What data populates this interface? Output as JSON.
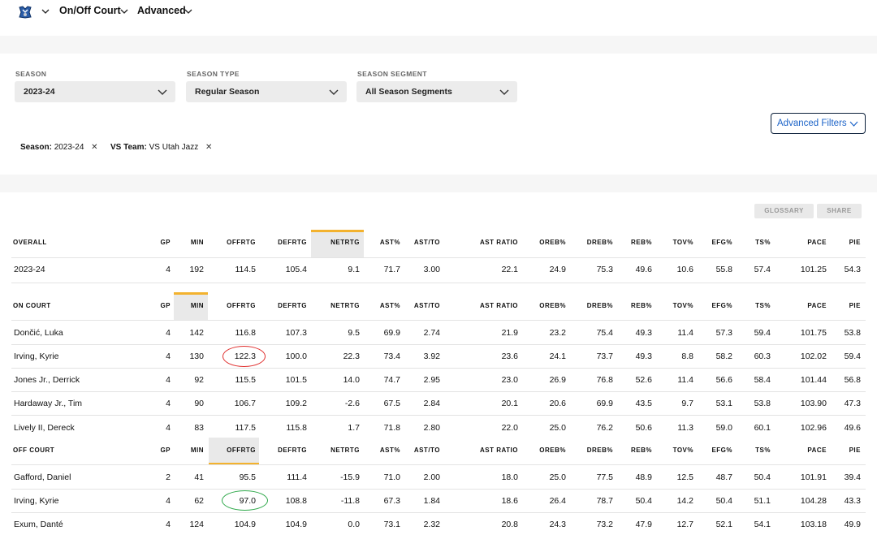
{
  "nav": {
    "team_logo": "mavericks-logo",
    "section": "On/Off Court",
    "mode": "Advanced"
  },
  "filters": {
    "season": {
      "label": "SEASON",
      "value": "2023-24"
    },
    "season_type": {
      "label": "SEASON TYPE",
      "value": "Regular Season"
    },
    "season_segment": {
      "label": "SEASON SEGMENT",
      "value": "All Season Segments"
    },
    "advanced_filters": "Advanced Filters"
  },
  "active_filters": [
    {
      "key": "Season:",
      "value": "2023-24"
    },
    {
      "key": "VS Team:",
      "value": "VS Utah Jazz"
    }
  ],
  "actions": {
    "glossary": "GLOSSARY",
    "share": "SHARE"
  },
  "colors": {
    "accent": "#f3b22e",
    "link": "#1d64c8",
    "red_circle": "#e0302f",
    "green_circle": "#2ea84a"
  },
  "columns": [
    "GP",
    "MIN",
    "OFFRTG",
    "DEFRTG",
    "NETRTG",
    "AST%",
    "AST/TO",
    "AST RATIO",
    "OREB%",
    "DREB%",
    "REB%",
    "TOV%",
    "EFG%",
    "TS%",
    "PACE",
    "PIE"
  ],
  "overall": {
    "title": "OVERALL",
    "highlight_column": "NETRTG",
    "rows": [
      {
        "name": "2023-24",
        "values": [
          "4",
          "192",
          "114.5",
          "105.4",
          "9.1",
          "71.7",
          "3.00",
          "22.1",
          "24.9",
          "75.3",
          "49.6",
          "10.6",
          "55.8",
          "57.4",
          "101.25",
          "54.3"
        ]
      }
    ]
  },
  "on_court": {
    "title": "ON COURT",
    "highlight_column": "MIN",
    "rows": [
      {
        "name": "Dončić, Luka",
        "values": [
          "4",
          "142",
          "116.8",
          "107.3",
          "9.5",
          "69.9",
          "2.74",
          "21.9",
          "23.2",
          "75.4",
          "49.3",
          "11.4",
          "57.3",
          "59.4",
          "101.75",
          "53.8"
        ]
      },
      {
        "name": "Irving, Kyrie",
        "values": [
          "4",
          "130",
          "122.3",
          "100.0",
          "22.3",
          "73.4",
          "3.92",
          "23.6",
          "24.1",
          "73.7",
          "49.3",
          "8.8",
          "58.2",
          "60.3",
          "102.02",
          "59.4"
        ]
      },
      {
        "name": "Jones Jr., Derrick",
        "values": [
          "4",
          "92",
          "115.5",
          "101.5",
          "14.0",
          "74.7",
          "2.95",
          "23.0",
          "26.9",
          "76.8",
          "52.6",
          "11.4",
          "56.6",
          "58.4",
          "101.44",
          "56.8"
        ]
      },
      {
        "name": "Hardaway Jr., Tim",
        "values": [
          "4",
          "90",
          "106.7",
          "109.2",
          "-2.6",
          "67.5",
          "2.84",
          "20.1",
          "20.6",
          "69.9",
          "43.5",
          "9.7",
          "53.1",
          "53.8",
          "103.90",
          "47.3"
        ]
      },
      {
        "name": "Lively II, Dereck",
        "values": [
          "4",
          "83",
          "117.5",
          "115.8",
          "1.7",
          "71.8",
          "2.80",
          "22.0",
          "25.0",
          "76.2",
          "50.6",
          "11.3",
          "59.0",
          "60.1",
          "102.96",
          "49.6"
        ]
      }
    ]
  },
  "off_court": {
    "title": "OFF COURT",
    "highlight_column": "OFFRTG",
    "rows": [
      {
        "name": "Gafford, Daniel",
        "values": [
          "2",
          "41",
          "95.5",
          "111.4",
          "-15.9",
          "71.0",
          "2.00",
          "18.0",
          "25.0",
          "77.5",
          "48.9",
          "12.5",
          "48.7",
          "50.4",
          "101.91",
          "39.4"
        ]
      },
      {
        "name": "Irving, Kyrie",
        "values": [
          "4",
          "62",
          "97.0",
          "108.8",
          "-11.8",
          "67.3",
          "1.84",
          "18.6",
          "26.4",
          "78.7",
          "50.4",
          "14.2",
          "50.4",
          "51.1",
          "104.28",
          "43.3"
        ]
      },
      {
        "name": "Exum, Danté",
        "values": [
          "4",
          "124",
          "104.9",
          "104.9",
          "0.0",
          "73.1",
          "2.32",
          "20.8",
          "24.3",
          "73.2",
          "47.9",
          "12.7",
          "52.1",
          "54.1",
          "103.18",
          "49.9"
        ]
      }
    ]
  }
}
